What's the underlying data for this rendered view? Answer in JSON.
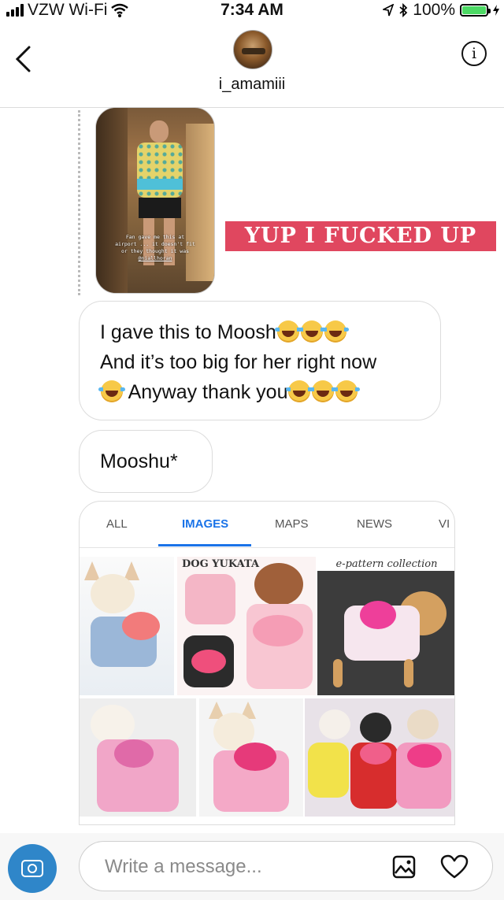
{
  "status_bar": {
    "carrier": "VZW Wi-Fi",
    "time": "7:34 AM",
    "battery_percent": "100%",
    "battery_level": 1.0
  },
  "header": {
    "username": "i_amamiii",
    "info_glyph": "i"
  },
  "story_reply": {
    "story_caption_lines": [
      "Fan gave me this at",
      "airport ... it doesn't fit",
      "or they thought it was",
      "@niallhoran"
    ],
    "reply_text": "YUP I FUCKED UP"
  },
  "messages": [
    {
      "lines": [
        "I gave this to Moosh",
        "And it’s too big for her right now",
        "Anyway thank you"
      ]
    },
    {
      "text": "Mooshu*"
    }
  ],
  "shared_search": {
    "tabs": [
      "ALL",
      "IMAGES",
      "MAPS",
      "NEWS",
      "VI"
    ],
    "active_tab": "IMAGES",
    "brand_label": "DOG YUKATA",
    "collection_label": "e-pattern collection"
  },
  "composer": {
    "placeholder": "Write a message..."
  },
  "colors": {
    "reply_bg": "#e0475f",
    "active_tab": "#1a73e8",
    "camera_button": "#2f86c9",
    "battery_fill": "#4cd964"
  }
}
